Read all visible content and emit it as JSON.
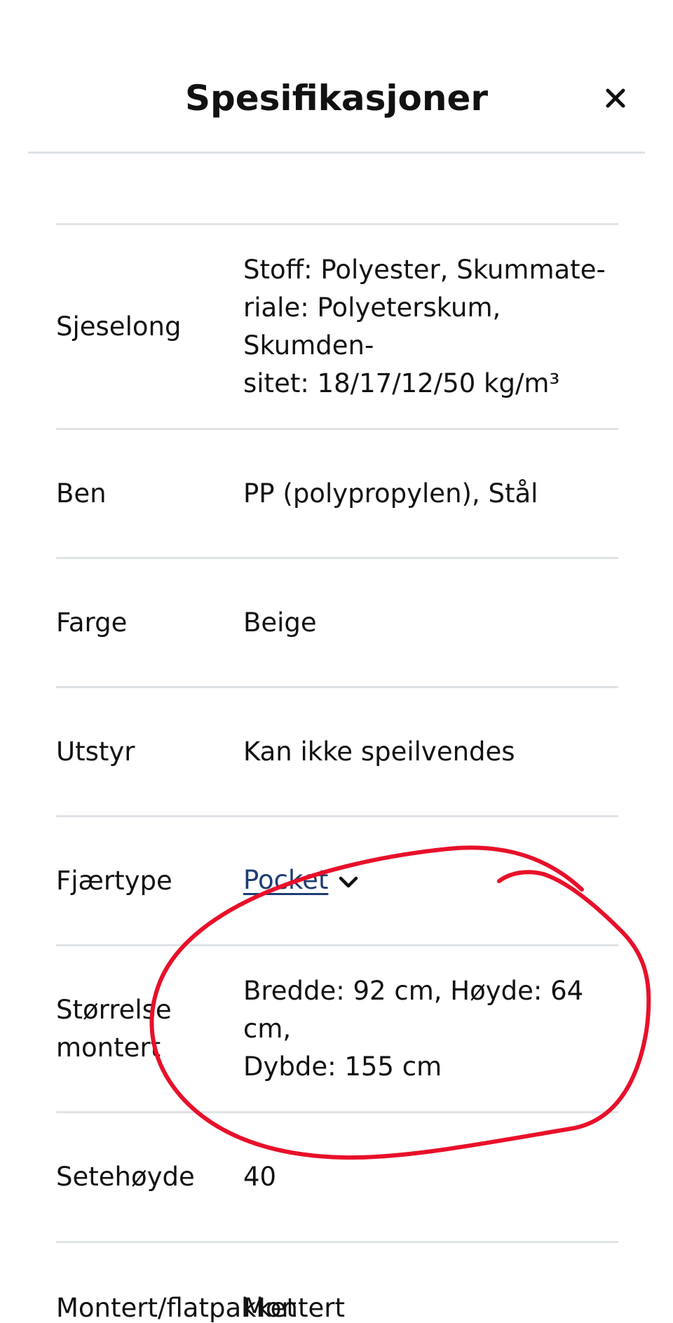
{
  "panel": {
    "title": "Spesifikasjoner",
    "close_icon": "close-icon"
  },
  "specs": [
    {
      "label": "Sjeselong",
      "value": "Stoff: Polyester, Skummate-\nriale: Polyeterskum, Skumden-\nsitet: 18/17/12/50 kg/m³"
    },
    {
      "label": "Ben",
      "value": "PP (polypropylen), Stål"
    },
    {
      "label": "Farge",
      "value": "Beige"
    },
    {
      "label": "Utstyr",
      "value": "Kan ikke speilvendes"
    },
    {
      "label": "Fjærtype",
      "value": "Pocket",
      "icon": "chevron-down-icon"
    },
    {
      "label": "Størrelse\nmontert",
      "value": "Bredde: 92 cm, Høyde: 64 cm,\nDybde: 155 cm"
    },
    {
      "label": "Setehøyde",
      "value": "40"
    },
    {
      "label": "Montert/flatpakket",
      "value": "Montert"
    }
  ],
  "annotation": {
    "color": "#e8102a",
    "icon": "hand-drawn-circle"
  }
}
